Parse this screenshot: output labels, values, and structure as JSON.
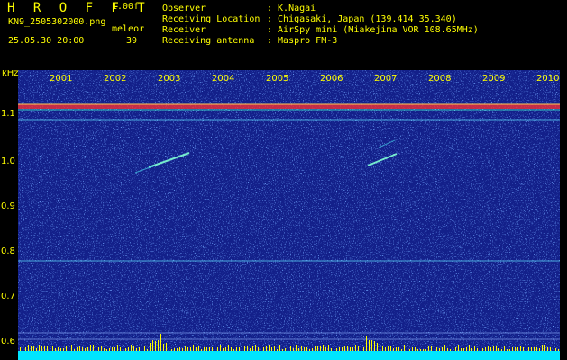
{
  "header": {
    "app_title": "H R O F F T",
    "version": "1.00f",
    "file_name": "KN9_2505302000.png",
    "meleor_label": "meleor",
    "meleor_count": "39",
    "date_time": "25.05.30 20:00"
  },
  "info": [
    {
      "key": "Observer",
      "value": ": K.Nagai"
    },
    {
      "key": "Receiving Location",
      "value": ": Chigasaki, Japan (139.414 35.340)"
    },
    {
      "key": "Receiver",
      "value": ": AirSpy mini (Miakejima VOR 108.65MHz)"
    },
    {
      "key": "Receiving antenna",
      "value": ": Maspro FM-3"
    }
  ],
  "spectrogram": {
    "y_unit": "kHz",
    "y_ticks": [
      "1.1",
      "1.0",
      "0.9",
      "0.8",
      "0.7",
      "0.6"
    ],
    "x_ticks": [
      "2001",
      "2002",
      "2003",
      "2004",
      "2005",
      "2006",
      "2007",
      "2008",
      "2009",
      "2010"
    ],
    "colors": {
      "background": "#13208a",
      "noise": "#2d5bd8",
      "carrier": "#ff3030",
      "bar": "#ffff00",
      "baseline": "#00e5ff"
    }
  }
}
